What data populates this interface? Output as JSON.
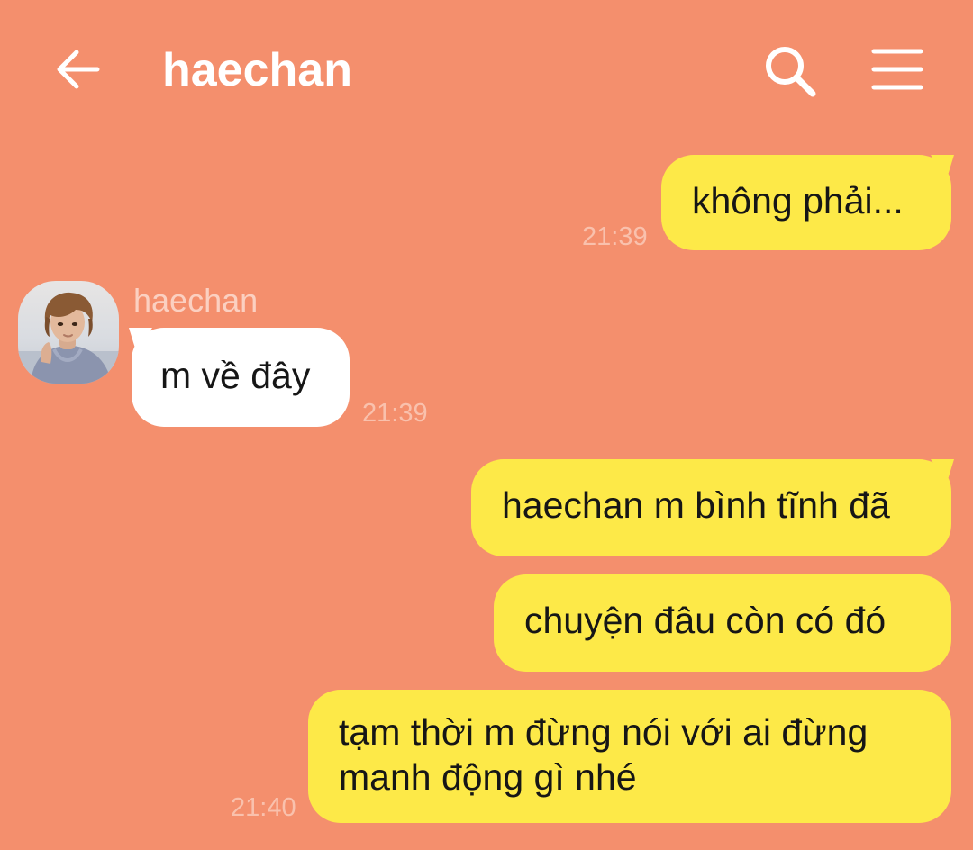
{
  "colors": {
    "background": "#f48f6d",
    "outgoing_bubble": "#fde948",
    "incoming_bubble": "#ffffff",
    "header_icons": "#ffffff",
    "timestamp": "#f9c1ad",
    "sender_name": "#fbd0c1"
  },
  "header": {
    "title": "haechan",
    "back_icon": "arrow-left-icon",
    "search_icon": "search-icon",
    "menu_icon": "hamburger-menu-icon"
  },
  "messages": [
    {
      "direction": "outgoing",
      "text": "không phải...",
      "time": "21:39"
    },
    {
      "direction": "incoming",
      "sender": "haechan",
      "text": "m về đây",
      "time": "21:39"
    },
    {
      "direction": "outgoing",
      "text": "haechan m bình tĩnh đã"
    },
    {
      "direction": "outgoing",
      "text": "chuyện đâu còn có đó"
    },
    {
      "direction": "outgoing",
      "text": "tạm thời m đừng nói với ai đừng manh động gì nhé",
      "lines": [
        "tạm thời m đừng nói với ai đừng",
        "manh động gì nhé"
      ],
      "time": "21:40"
    }
  ]
}
